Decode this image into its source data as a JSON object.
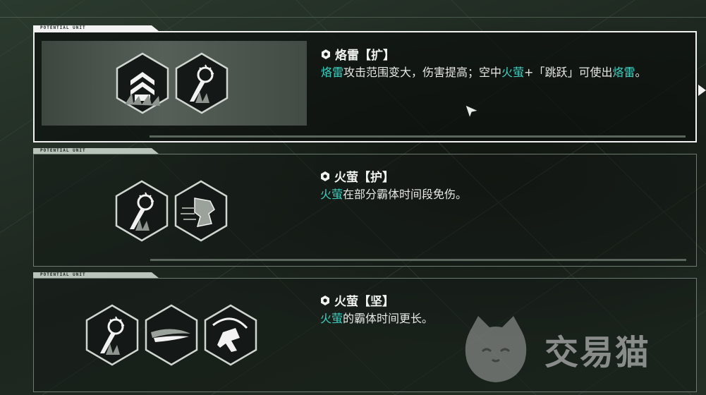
{
  "colors": {
    "highlight": "#3fd1c1",
    "text": "#e6e9e6",
    "selected_border": "#f2f2f2",
    "card_border": "#6d7a6f"
  },
  "cards": [
    {
      "tab_label": "POTENTIAL UNIT",
      "title": "烙雷【扩】",
      "selected": true,
      "desc": [
        {
          "t": "烙雷",
          "hl": true
        },
        {
          "t": "攻击范围变大，伤害提高；空中",
          "hl": false
        },
        {
          "t": "火萤",
          "hl": true
        },
        {
          "t": "+「跳跃」可使出",
          "hl": false
        },
        {
          "t": "烙雷",
          "hl": true
        },
        {
          "t": "。",
          "hl": false
        }
      ],
      "icons": [
        "chevron-rank-icon",
        "firefly-orb-icon"
      ]
    },
    {
      "tab_label": "POTENTIAL UNIT",
      "title": "火萤【护】",
      "selected": false,
      "desc": [
        {
          "t": "火萤",
          "hl": true
        },
        {
          "t": "在部分霸体时间段免伤。",
          "hl": false
        }
      ],
      "icons": [
        "firefly-orb-icon",
        "dash-boots-icon"
      ]
    },
    {
      "tab_label": "POTENTIAL UNIT",
      "title": "火萤【坚】",
      "selected": false,
      "desc": [
        {
          "t": "火萤",
          "hl": true
        },
        {
          "t": "的霸体时间更长。",
          "hl": false
        }
      ],
      "icons": [
        "firefly-orb-icon",
        "speed-streak-icon",
        "slash-kick-icon"
      ]
    }
  ],
  "watermark": {
    "text": "交易猫",
    "icon": "cat-logo-icon"
  }
}
